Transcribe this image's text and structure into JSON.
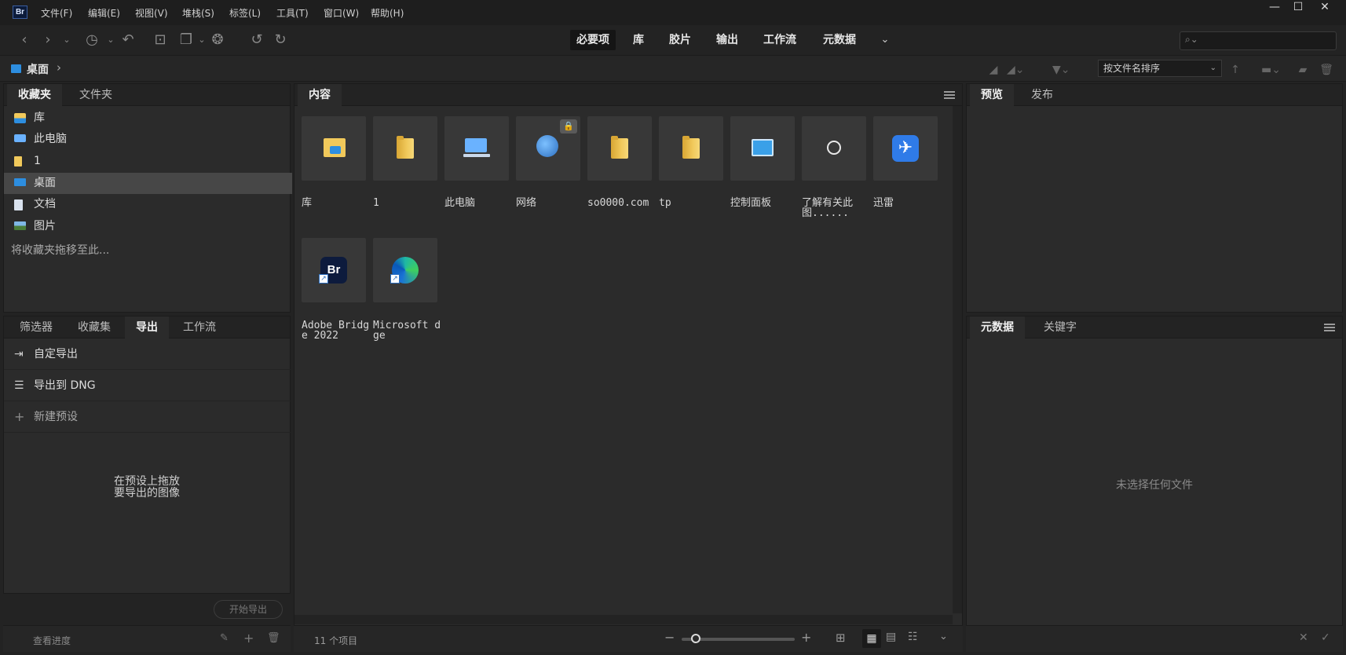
{
  "app": {
    "logo_text": "Br"
  },
  "menu": [
    "文件(F)",
    "编辑(E)",
    "视图(V)",
    "堆栈(S)",
    "标签(L)",
    "工具(T)",
    "窗口(W)",
    "帮助(H)"
  ],
  "window_controls": {
    "minimize": "—",
    "maximize": "☐",
    "close": "✕"
  },
  "workspaces": [
    "必要项",
    "库",
    "胶片",
    "输出",
    "工作流",
    "元数据"
  ],
  "path": {
    "current": "桌面",
    "chevron": "›"
  },
  "sort": {
    "label": "按文件名排序"
  },
  "left_top": {
    "tabs": [
      "收藏夹",
      "文件夹"
    ],
    "items": [
      {
        "label": "库",
        "icon": "library-folder-icon"
      },
      {
        "label": "此电脑",
        "icon": "computer-icon"
      },
      {
        "label": "1",
        "icon": "folder-icon"
      },
      {
        "label": "桌面",
        "icon": "desktop-icon"
      },
      {
        "label": "文档",
        "icon": "document-icon"
      },
      {
        "label": "图片",
        "icon": "picture-icon"
      }
    ],
    "drop_hint": "将收藏夹拖移至此..."
  },
  "left_bottom": {
    "tabs": [
      "筛选器",
      "收藏集",
      "导出",
      "工作流"
    ],
    "rows": [
      "自定导出",
      "导出到 DNG",
      "新建预设"
    ],
    "drop_hint_line1": "在预设上拖放",
    "drop_hint_line2": "要导出的图像",
    "start_button": "开始导出",
    "progress_link": "查看进度"
  },
  "content": {
    "tab": "内容",
    "items": [
      {
        "label": "库",
        "icon": "library-folder-icon"
      },
      {
        "label": "1",
        "icon": "folder-icon"
      },
      {
        "label": "此电脑",
        "icon": "computer-icon"
      },
      {
        "label": "网络",
        "icon": "network-icon"
      },
      {
        "label": "so0000.com",
        "icon": "folder-icon"
      },
      {
        "label": "tp",
        "icon": "folder-icon"
      },
      {
        "label": "控制面板",
        "icon": "control-panel-icon"
      },
      {
        "label": "了解有关此图......",
        "icon": "info-icon"
      },
      {
        "label": "迅雷",
        "icon": "thunder-icon"
      },
      {
        "label": "Adobe Bridge 2022",
        "icon": "bridge-shortcut-icon"
      },
      {
        "label": "Microsoft dge",
        "icon": "edge-shortcut-icon"
      }
    ],
    "status": "11 个项目"
  },
  "right_top": {
    "tabs": [
      "预览",
      "发布"
    ]
  },
  "right_bottom": {
    "tabs": [
      "元数据",
      "关键字"
    ],
    "empty_text": "未选择任何文件"
  },
  "colors": {
    "accent_folder": "#f1c95b",
    "desktop_blue": "#2d8ee0"
  }
}
